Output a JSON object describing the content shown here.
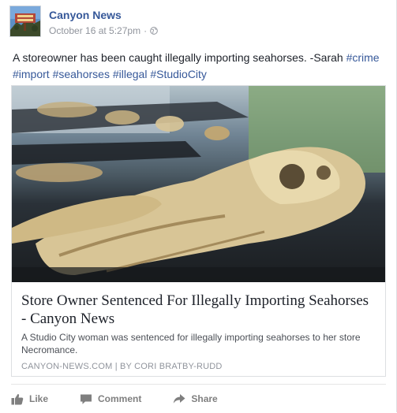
{
  "page": {
    "name": "Canyon News",
    "timestamp": "October 16 at 5:27pm",
    "separator": "·"
  },
  "post": {
    "text": "A storeowner has been caught illegally importing seahorses. -Sarah ",
    "hashtags": [
      "#crime",
      "#import",
      "#seahorses",
      "#illegal",
      "#StudioCity"
    ]
  },
  "link_preview": {
    "title": "Store Owner Sentenced For Illegally Importing Seahorses - Canyon News",
    "description": "A Studio City woman was sentenced for illegally importing seahorses to her store Necromance.",
    "source": "CANYON-NEWS.COM | BY CORI BRATBY-RUDD"
  },
  "actions": {
    "like": "Like",
    "comment": "Comment",
    "share": "Share"
  },
  "icons": {
    "avatar": "canyon-news-logo",
    "globe": "globe-icon",
    "like": "thumbs-up-icon",
    "comment": "comment-bubble-icon",
    "share": "share-arrow-icon"
  },
  "colors": {
    "link": "#365899",
    "text": "#1d2129",
    "muted": "#90949c",
    "action": "#7f7f7f"
  }
}
